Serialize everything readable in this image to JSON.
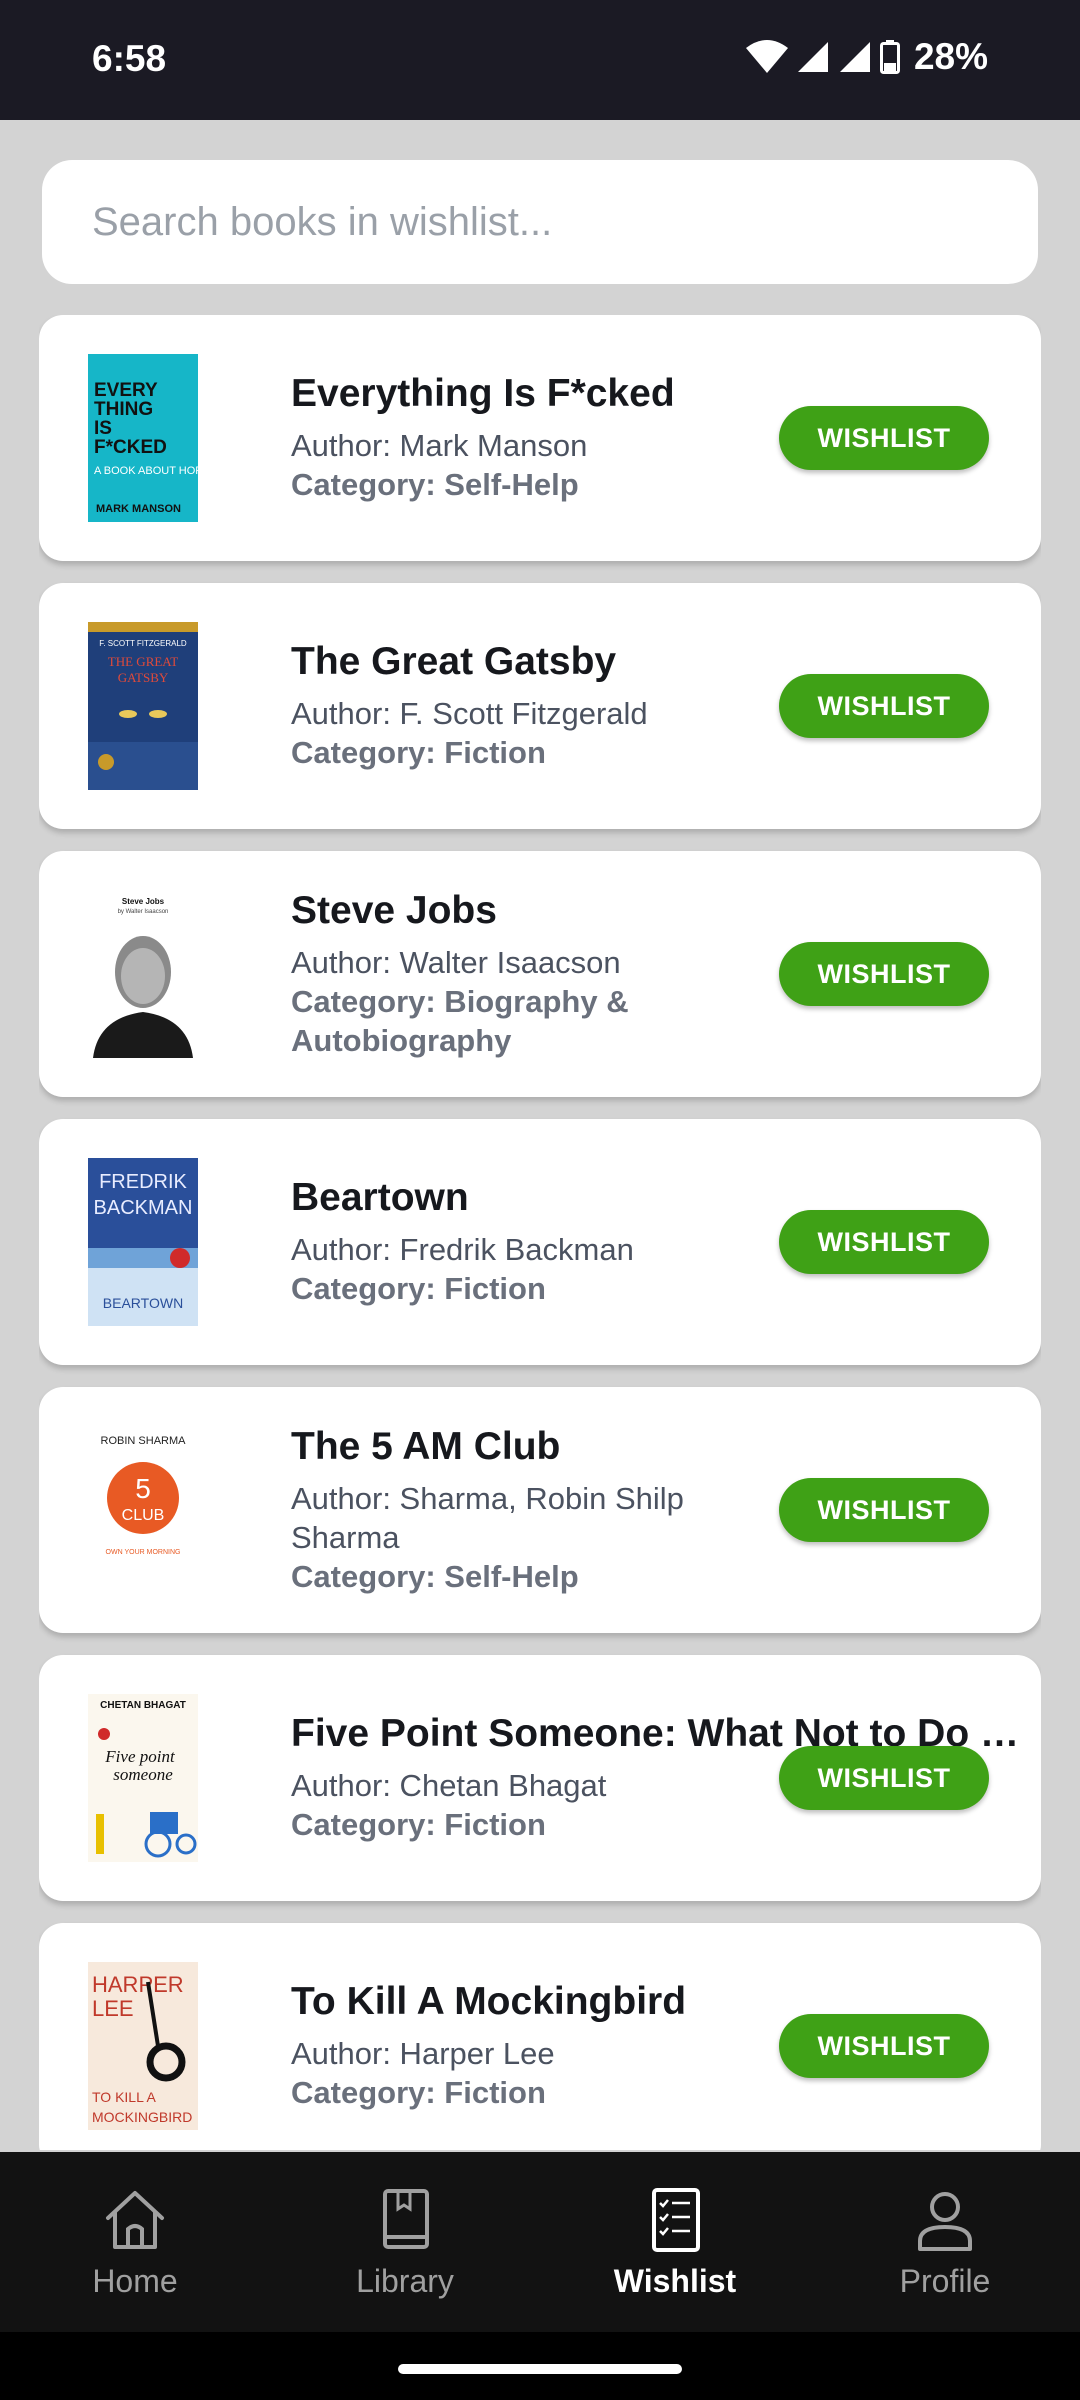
{
  "status": {
    "time": "6:58",
    "battery": "28%"
  },
  "search": {
    "placeholder": "Search books in wishlist..."
  },
  "books": [
    {
      "title": "Everything Is F*cked",
      "author": "Author: Mark Manson",
      "category": "Category: Self-Help",
      "button": "WISHLIST"
    },
    {
      "title": "The Great Gatsby",
      "author": "Author: F. Scott Fitzgerald",
      "category": "Category: Fiction",
      "button": "WISHLIST"
    },
    {
      "title": "Steve Jobs",
      "author": "Author: Walter Isaacson",
      "category": "Category: Biography & Autobiography",
      "button": "WISHLIST"
    },
    {
      "title": "Beartown",
      "author": "Author: Fredrik Backman",
      "category": "Category: Fiction",
      "button": "WISHLIST"
    },
    {
      "title": "The 5 AM Club",
      "author": "Author: Sharma, Robin Shilp Sharma",
      "category": "Category: Self-Help",
      "button": "WISHLIST"
    },
    {
      "title": "Five Point Someone: What Not to Do at IIT!",
      "author": "Author: Chetan Bhagat",
      "category": "Category: Fiction",
      "button": "WISHLIST"
    },
    {
      "title": "To Kill A Mockingbird",
      "author": "Author: Harper Lee",
      "category": "Category: Fiction",
      "button": "WISHLIST"
    }
  ],
  "covers": {
    "c0": {
      "line1": "EVERY",
      "line2": "THING",
      "line3": "IS",
      "line4": "F*CKED",
      "sub": "A BOOK ABOUT HOPE",
      "author": "MARK MANSON"
    },
    "c1": {
      "top": "F. SCOTT FITZGERALD",
      "title1": "THE GREAT",
      "title2": "GATSBY"
    },
    "c2": {
      "title": "Steve Jobs",
      "sub": "by Walter Isaacson"
    },
    "c3": {
      "a1": "FREDRIK",
      "a2": "BACKMAN",
      "title": "BEARTOWN"
    },
    "c4": {
      "author": "ROBIN SHARMA",
      "num": "5",
      "club": "CLUB",
      "tag": "OWN YOUR MORNING"
    },
    "c5": {
      "author": "CHETAN BHAGAT",
      "t1": "Five point",
      "t2": "someone"
    },
    "c6": {
      "a1": "HARPER",
      "a2": "LEE",
      "t1": "TO KILL A",
      "t2": "MOCKINGBIRD"
    }
  },
  "nav": [
    {
      "label": "Home",
      "icon": "home-icon"
    },
    {
      "label": "Library",
      "icon": "book-icon"
    },
    {
      "label": "Wishlist",
      "icon": "checklist-icon"
    },
    {
      "label": "Profile",
      "icon": "person-icon"
    }
  ],
  "colors": {
    "accent": "#3fa116",
    "status_bar": "#1b1a24",
    "nav_bg": "#121212"
  }
}
